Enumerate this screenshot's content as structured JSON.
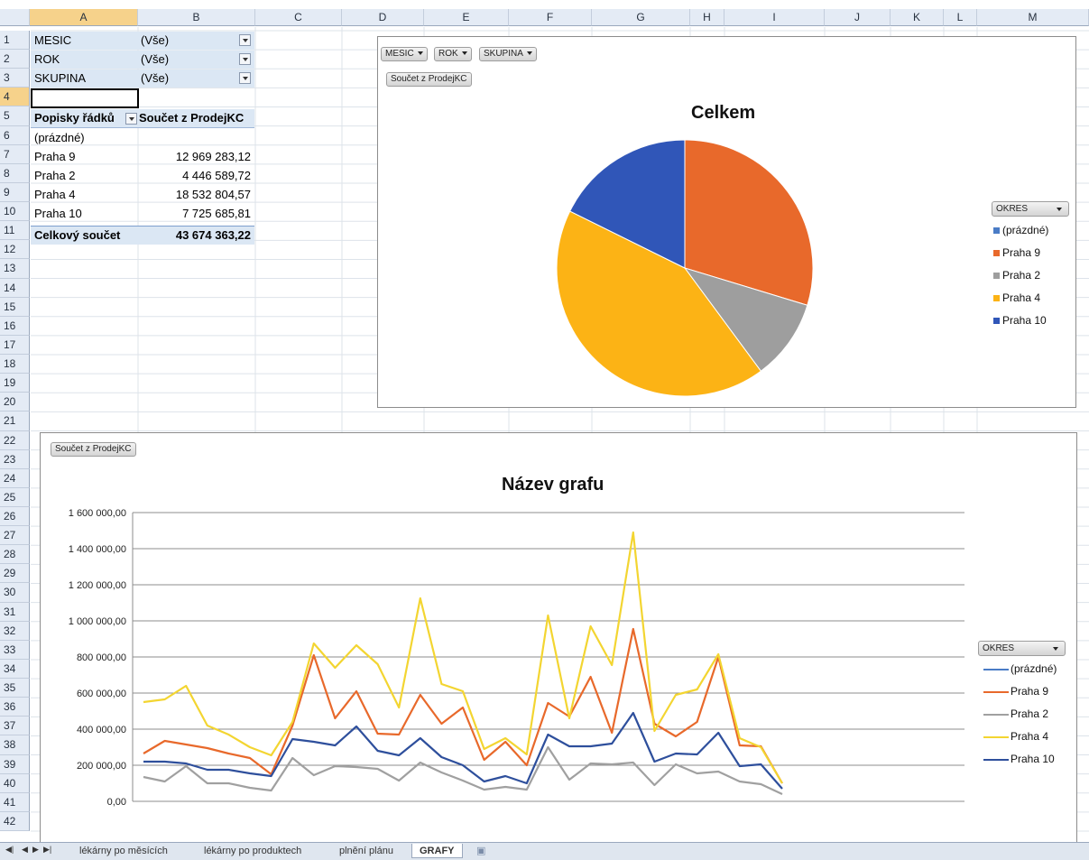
{
  "columns": [
    "A",
    "B",
    "C",
    "D",
    "E",
    "F",
    "G",
    "H",
    "I",
    "J",
    "K",
    "L",
    "M"
  ],
  "rows": [
    "1",
    "2",
    "3",
    "4",
    "5",
    "6",
    "7",
    "8",
    "9",
    "10",
    "11",
    "12",
    "13",
    "14",
    "15",
    "16",
    "17",
    "18",
    "19",
    "20",
    "21",
    "22",
    "23",
    "24",
    "25",
    "26",
    "27",
    "28",
    "29",
    "30",
    "31",
    "32",
    "33",
    "34",
    "35",
    "36",
    "37",
    "38",
    "39",
    "40",
    "41",
    "42"
  ],
  "pivot": {
    "filters": [
      {
        "name": "MESIC",
        "value": "(Vše)"
      },
      {
        "name": "ROK",
        "value": "(Vše)"
      },
      {
        "name": "SKUPINA",
        "value": "(Vše)"
      }
    ],
    "header_labels": "Popisky řádků",
    "header_sum": "Součet z ProdejKC",
    "rows": [
      {
        "label": "(prázdné)",
        "value": ""
      },
      {
        "label": "Praha 9",
        "value": "12 969 283,12"
      },
      {
        "label": "Praha 2",
        "value": "4 446 589,72"
      },
      {
        "label": "Praha 4",
        "value": "18 532 804,57"
      },
      {
        "label": "Praha 10",
        "value": "7 725 685,81"
      }
    ],
    "total_label": "Celkový součet",
    "total_value": "43 674 363,22"
  },
  "pie_chart": {
    "field_buttons": [
      "MESIC",
      "ROK",
      "SKUPINA"
    ],
    "value_button": "Součet z ProdejKC",
    "legend_button": "OKRES"
  },
  "line_chart": {
    "value_button": "Součet z ProdejKC",
    "legend_button": "OKRES",
    "ytick_labels": [
      "0,00",
      "200 000,00",
      "400 000,00",
      "600 000,00",
      "800 000,00",
      "1 000 000,00",
      "1 200 000,00",
      "1 400 000,00",
      "1 600 000,00"
    ]
  },
  "chart_data": [
    {
      "type": "pie",
      "title": "Celkem",
      "categories": [
        "(prázdné)",
        "Praha 9",
        "Praha 2",
        "Praha 4",
        "Praha 10"
      ],
      "values": [
        0,
        12969283.12,
        4446589.72,
        18532804.57,
        7725685.81
      ],
      "colors": [
        "#4a7cc6",
        "#e8692b",
        "#9e9e9e",
        "#fcb315",
        "#3056b8"
      ],
      "legend_placement": "right"
    },
    {
      "type": "line",
      "title": "Název grafu",
      "ylim": [
        0,
        1600000
      ],
      "yticks": [
        0,
        200000,
        400000,
        600000,
        800000,
        1000000,
        1200000,
        1400000,
        1600000
      ],
      "grid": true,
      "legend_placement": "right",
      "x": [
        1,
        2,
        3,
        4,
        5,
        6,
        7,
        8,
        9,
        10,
        11,
        12,
        13,
        14,
        15,
        16,
        17,
        18,
        19,
        20,
        21,
        22,
        23,
        24,
        25,
        26,
        27,
        28,
        29,
        30,
        31,
        32,
        33,
        34,
        35,
        36,
        37
      ],
      "series": [
        {
          "name": "(prázdné)",
          "color": "#4a7cc6",
          "values": []
        },
        {
          "name": "Praha 9",
          "color": "#e8692b",
          "values": [
            265000,
            335000,
            315000,
            295000,
            265000,
            240000,
            150000,
            420000,
            810000,
            460000,
            610000,
            375000,
            370000,
            590000,
            430000,
            520000,
            230000,
            330000,
            200000,
            545000,
            470000,
            690000,
            380000,
            955000,
            430000,
            360000,
            440000,
            800000,
            310000,
            305000,
            100000
          ]
        },
        {
          "name": "Praha 2",
          "color": "#a0a0a0",
          "values": [
            135000,
            110000,
            195000,
            100000,
            100000,
            75000,
            60000,
            240000,
            145000,
            195000,
            190000,
            180000,
            115000,
            215000,
            160000,
            115000,
            65000,
            80000,
            65000,
            300000,
            120000,
            210000,
            205000,
            215000,
            90000,
            205000,
            155000,
            165000,
            110000,
            95000,
            40000
          ]
        },
        {
          "name": "Praha 4",
          "color": "#f3d531",
          "values": [
            550000,
            565000,
            640000,
            420000,
            370000,
            300000,
            255000,
            440000,
            875000,
            740000,
            865000,
            760000,
            520000,
            1125000,
            650000,
            610000,
            290000,
            350000,
            260000,
            1030000,
            460000,
            970000,
            755000,
            1490000,
            390000,
            590000,
            620000,
            815000,
            350000,
            300000,
            100000
          ]
        },
        {
          "name": "Praha 10",
          "color": "#2e4f9c",
          "values": [
            220000,
            220000,
            210000,
            175000,
            175000,
            155000,
            140000,
            345000,
            330000,
            310000,
            415000,
            280000,
            255000,
            350000,
            245000,
            200000,
            110000,
            140000,
            100000,
            370000,
            305000,
            305000,
            320000,
            490000,
            220000,
            265000,
            260000,
            380000,
            195000,
            205000,
            70000
          ]
        }
      ]
    }
  ],
  "sheet_tabs": [
    "lékárny po měsících",
    "lékárny po produktech",
    "plnění plánu",
    "GRAFY"
  ]
}
